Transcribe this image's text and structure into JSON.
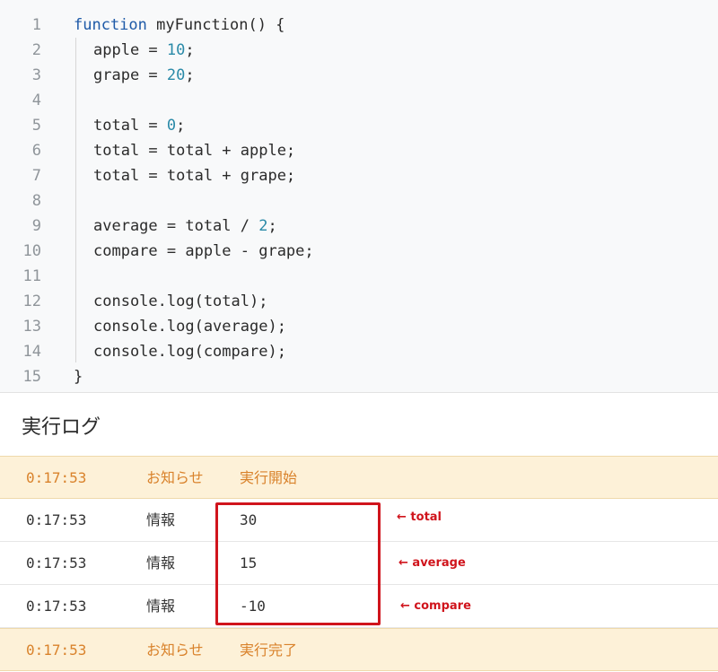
{
  "code": {
    "lines": [
      {
        "n": "1",
        "segments": [
          {
            "t": "function",
            "k": "kw"
          },
          {
            "t": " myFunction() {",
            "k": ""
          }
        ]
      },
      {
        "n": "2",
        "segments": [
          {
            "t": "apple = ",
            "k": ""
          },
          {
            "t": "10",
            "k": "num"
          },
          {
            "t": ";",
            "k": ""
          }
        ]
      },
      {
        "n": "3",
        "segments": [
          {
            "t": "grape = ",
            "k": ""
          },
          {
            "t": "20",
            "k": "num"
          },
          {
            "t": ";",
            "k": ""
          }
        ]
      },
      {
        "n": "4",
        "segments": []
      },
      {
        "n": "5",
        "segments": [
          {
            "t": "total = ",
            "k": ""
          },
          {
            "t": "0",
            "k": "num"
          },
          {
            "t": ";",
            "k": ""
          }
        ]
      },
      {
        "n": "6",
        "segments": [
          {
            "t": "total = total + apple;",
            "k": ""
          }
        ]
      },
      {
        "n": "7",
        "segments": [
          {
            "t": "total = total + grape;",
            "k": ""
          }
        ]
      },
      {
        "n": "8",
        "segments": []
      },
      {
        "n": "9",
        "segments": [
          {
            "t": "average = total / ",
            "k": ""
          },
          {
            "t": "2",
            "k": "num"
          },
          {
            "t": ";",
            "k": ""
          }
        ]
      },
      {
        "n": "10",
        "segments": [
          {
            "t": "compare = apple - grape;",
            "k": ""
          }
        ]
      },
      {
        "n": "11",
        "segments": []
      },
      {
        "n": "12",
        "segments": [
          {
            "t": "console.log(total);",
            "k": ""
          }
        ]
      },
      {
        "n": "13",
        "segments": [
          {
            "t": "console.log(average);",
            "k": ""
          }
        ]
      },
      {
        "n": "14",
        "segments": [
          {
            "t": "console.log(compare);",
            "k": ""
          }
        ]
      },
      {
        "n": "15",
        "segments": [
          {
            "t": "}",
            "k": ""
          }
        ]
      }
    ]
  },
  "log": {
    "title": "実行ログ",
    "rows": [
      {
        "kind": "notice",
        "time": "0:17:53",
        "level": "お知らせ",
        "message": "実行開始"
      },
      {
        "kind": "info",
        "time": "0:17:53",
        "level": "情報",
        "message": "30"
      },
      {
        "kind": "info",
        "time": "0:17:53",
        "level": "情報",
        "message": "15"
      },
      {
        "kind": "info",
        "time": "0:17:53",
        "level": "情報",
        "message": "-10"
      },
      {
        "kind": "notice",
        "time": "0:17:53",
        "level": "お知らせ",
        "message": "実行完了"
      }
    ]
  },
  "annotations": [
    {
      "text": "← total"
    },
    {
      "text": "← average"
    },
    {
      "text": "← compare"
    }
  ],
  "colors": {
    "keyword": "#1e5aa8",
    "number": "#2a8aa8",
    "notice_text": "#d9822b",
    "notice_bg": "#fdf1d8",
    "annotation_red": "#d0141c"
  }
}
